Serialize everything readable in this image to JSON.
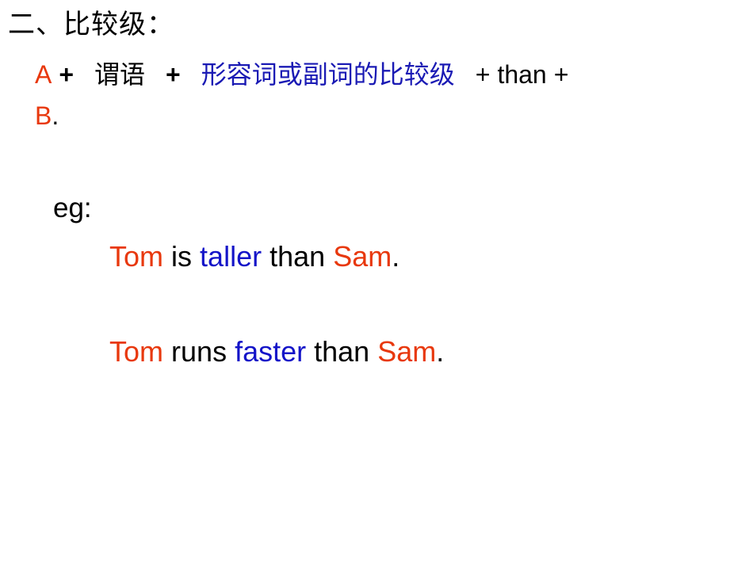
{
  "slide": {
    "background_color": "#ffffff",
    "title": "二、比较级：",
    "colors": {
      "red": "#e8380d",
      "blue": "#1414c8",
      "black": "#000000",
      "zh_blue": "#1a1ab4"
    },
    "formula": {
      "subject_a": "A",
      "plus_1": "+",
      "predicate": "谓语",
      "plus_2": "+",
      "comparative_phrase": "形容词或副词的比较级",
      "plus_3": "+",
      "than": "than",
      "plus_4": "+",
      "subject_b": "B",
      "period": "."
    },
    "eg_label": "eg:",
    "examples": [
      {
        "subject": "Tom",
        "verb": "is",
        "comparative": "taller",
        "than": "than",
        "object": "Sam",
        "period": "."
      },
      {
        "subject": "Tom",
        "verb": "runs",
        "comparative": "faster",
        "than": "than",
        "object": "Sam",
        "period": "."
      }
    ]
  }
}
